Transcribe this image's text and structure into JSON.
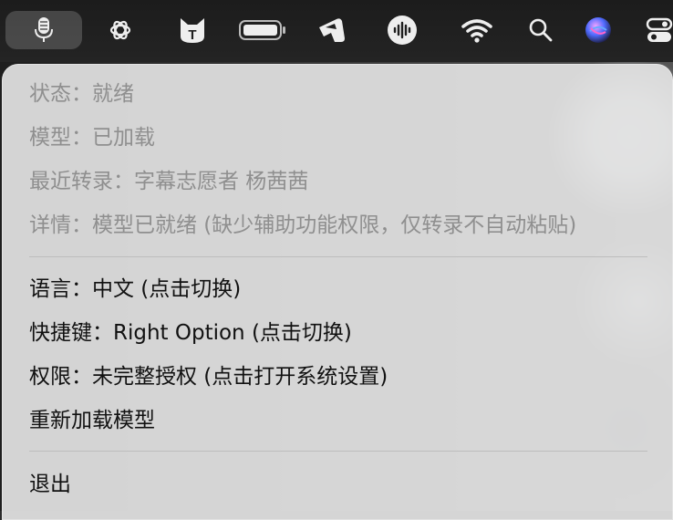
{
  "menubar": {
    "icons": [
      "microphone-icon",
      "openai-icon",
      "cat-icon",
      "battery-icon",
      "drive-icon",
      "audio-wave-icon",
      "wifi-icon",
      "search-icon",
      "siri-icon",
      "control-center-icon"
    ]
  },
  "menu": {
    "status": "状态：就绪",
    "model": "模型：已加载",
    "recent": "最近转录：字幕志愿者 杨茜茜",
    "details": "详情：模型已就绪 (缺少辅助功能权限，仅转录不自动粘贴)",
    "language": "语言：中文 (点击切换)",
    "shortcut": "快捷键：Right Option (点击切换)",
    "permission": "权限：未完整授权 (点击打开系统设置)",
    "reload": "重新加载模型",
    "quit": "退出"
  }
}
